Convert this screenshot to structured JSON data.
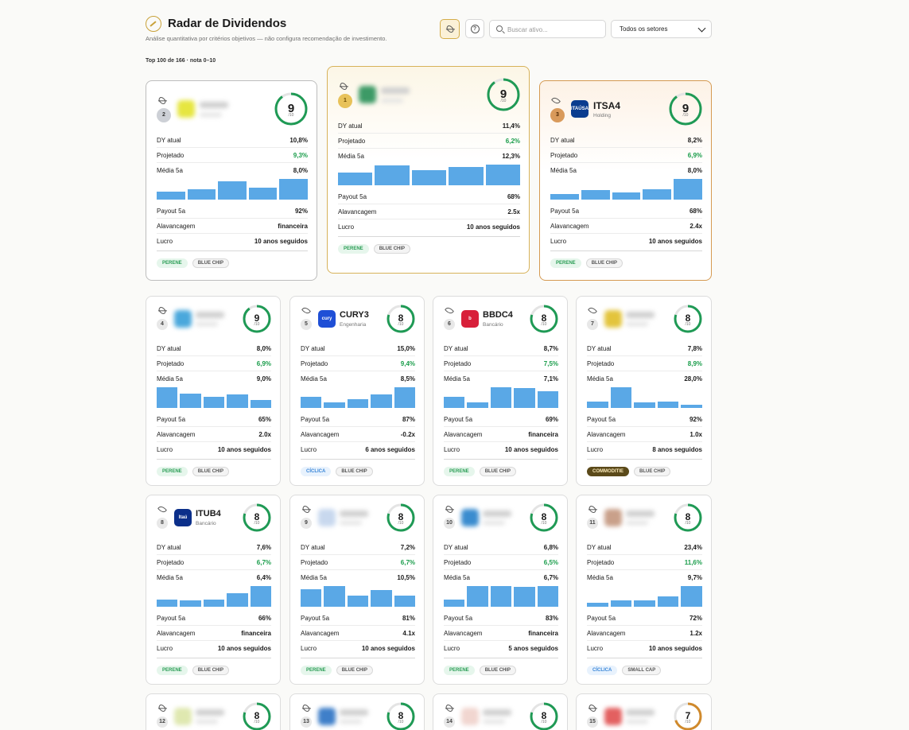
{
  "header": {
    "title": "Radar de Dividendos",
    "subtitle": "Análise quantitativa por critérios objetivos — não configura recomendação de investimento.",
    "search_placeholder": "Buscar ativo...",
    "sector_select": "Todos os setores",
    "count": "Top 100 de 166 · nota 0–10"
  },
  "labels": {
    "dy": "DY atual",
    "proj": "Projetado",
    "media": "Média 5a",
    "payout": "Payout 5a",
    "alav": "Alavancagem",
    "lucro": "Lucro",
    "of10": "/10"
  },
  "colors": {
    "accent": "#c9a23a",
    "bar": "#5aa8e6",
    "ring_green": "#1f9a55",
    "ring_orange": "#d08a2c",
    "positive": "#1a9d4b"
  },
  "podium": [
    {
      "rank": "2",
      "ticker": "",
      "sector": "",
      "score": "9",
      "dy": "10,8%",
      "proj": "9,3%",
      "media": "8,0%",
      "bars": [
        0.38,
        0.5,
        0.9,
        0.58,
        1.0
      ],
      "payout": "92%",
      "alav": "financeira",
      "lucro": "10 anos seguidos",
      "tags": [
        "PERENE",
        "BLUE CHIP"
      ],
      "blurred": true,
      "logo_color": "#e6e640"
    },
    {
      "rank": "1",
      "ticker": "",
      "sector": "",
      "score": "9",
      "dy": "11,4%",
      "proj": "6,2%",
      "media": "12,3%",
      "bars": [
        0.6,
        0.95,
        0.75,
        0.88,
        1.0
      ],
      "payout": "68%",
      "alav": "2.5x",
      "lucro": "10 anos seguidos",
      "tags": [
        "PERENE",
        "BLUE CHIP"
      ],
      "blurred": true,
      "logo_color": "#3d9a66"
    },
    {
      "rank": "3",
      "ticker": "ITSA4",
      "sector": "Holding",
      "score": "9",
      "dy": "8,2%",
      "proj": "6,9%",
      "media": "8,0%",
      "bars": [
        0.28,
        0.45,
        0.35,
        0.5,
        1.0
      ],
      "payout": "68%",
      "alav": "2.4x",
      "lucro": "10 anos seguidos",
      "tags": [
        "PERENE",
        "BLUE CHIP"
      ],
      "blurred": false,
      "logo_color": "#0a3d8f",
      "logo_text": "ITAÚSA"
    }
  ],
  "cards": [
    {
      "rank": "4",
      "ticker": "",
      "sector": "",
      "score": "9",
      "dy": "8,0%",
      "proj": "6,9%",
      "media": "9,0%",
      "bars": [
        1.0,
        0.7,
        0.55,
        0.65,
        0.4
      ],
      "payout": "65%",
      "alav": "2.0x",
      "lucro": "10 anos seguidos",
      "tags": [
        "PERENE",
        "BLUE CHIP"
      ],
      "blurred": true,
      "logo_color": "#4aa8dc",
      "eye": "slash"
    },
    {
      "rank": "5",
      "ticker": "CURY3",
      "sector": "Engenharia",
      "score": "8",
      "dy": "15,0%",
      "proj": "9,4%",
      "media": "8,5%",
      "bars": [
        0.55,
        0.28,
        0.42,
        0.65,
        1.0
      ],
      "payout": "87%",
      "alav": "-0.2x",
      "lucro": "6 anos seguidos",
      "tags": [
        "CÍCLICA",
        "BLUE CHIP"
      ],
      "blurred": false,
      "logo_color": "#1f4fd6",
      "logo_text": "cury",
      "eye": "open"
    },
    {
      "rank": "6",
      "ticker": "BBDC4",
      "sector": "Bancário",
      "score": "8",
      "dy": "8,7%",
      "proj": "7,5%",
      "media": "7,1%",
      "bars": [
        0.52,
        0.28,
        1.0,
        0.95,
        0.8
      ],
      "payout": "69%",
      "alav": "financeira",
      "lucro": "10 anos seguidos",
      "tags": [
        "PERENE",
        "BLUE CHIP"
      ],
      "blurred": false,
      "logo_color": "#d8203a",
      "logo_text": "b",
      "eye": "open"
    },
    {
      "rank": "7",
      "ticker": "",
      "sector": "",
      "score": "8",
      "dy": "7,8%",
      "proj": "8,9%",
      "media": "28,0%",
      "bars": [
        0.3,
        1.0,
        0.27,
        0.32,
        0.15
      ],
      "payout": "92%",
      "alav": "1.0x",
      "lucro": "8 anos seguidos",
      "tags": [
        "COMMODITIE",
        "BLUE CHIP"
      ],
      "blurred": true,
      "logo_color": "#e3c43c",
      "eye": "open"
    },
    {
      "rank": "8",
      "ticker": "ITUB4",
      "sector": "Bancário",
      "score": "8",
      "dy": "7,6%",
      "proj": "6,7%",
      "media": "6,4%",
      "bars": [
        0.35,
        0.3,
        0.33,
        0.65,
        1.0
      ],
      "payout": "66%",
      "alav": "financeira",
      "lucro": "10 anos seguidos",
      "tags": [
        "PERENE",
        "BLUE CHIP"
      ],
      "blurred": false,
      "logo_color": "#0b2f8a",
      "logo_text": "Itaú",
      "eye": "open"
    },
    {
      "rank": "9",
      "ticker": "",
      "sector": "",
      "score": "8",
      "dy": "7,2%",
      "proj": "6,7%",
      "media": "10,5%",
      "bars": [
        0.85,
        1.0,
        0.55,
        0.8,
        0.55
      ],
      "payout": "81%",
      "alav": "4.1x",
      "lucro": "10 anos seguidos",
      "tags": [
        "PERENE",
        "BLUE CHIP"
      ],
      "blurred": true,
      "logo_color": "#c8d8ee",
      "eye": "slash"
    },
    {
      "rank": "10",
      "ticker": "",
      "sector": "",
      "score": "8",
      "dy": "6,8%",
      "proj": "6,5%",
      "media": "6,7%",
      "bars": [
        0.35,
        1.0,
        1.0,
        0.95,
        1.0
      ],
      "payout": "83%",
      "alav": "financeira",
      "lucro": "5 anos seguidos",
      "tags": [
        "PERENE",
        "BLUE CHIP"
      ],
      "blurred": true,
      "logo_color": "#3a8ccf",
      "eye": "slash"
    },
    {
      "rank": "11",
      "ticker": "",
      "sector": "",
      "score": "8",
      "dy": "23,4%",
      "proj": "11,6%",
      "media": "9,7%",
      "bars": [
        0.2,
        0.3,
        0.32,
        0.5,
        1.0
      ],
      "payout": "72%",
      "alav": "1.2x",
      "lucro": "10 anos seguidos",
      "tags": [
        "CÍCLICA",
        "SMALL CAP"
      ],
      "blurred": true,
      "logo_color": "#c9a08a",
      "eye": "slash"
    },
    {
      "rank": "12",
      "ticker": "",
      "sector": "",
      "score": "8",
      "blurred": true,
      "logo_color": "#dfe8b0",
      "eye": "slash"
    },
    {
      "rank": "13",
      "ticker": "",
      "sector": "",
      "score": "8",
      "blurred": true,
      "logo_color": "#3f7fc9",
      "eye": "slash"
    },
    {
      "rank": "14",
      "ticker": "",
      "sector": "",
      "score": "8",
      "blurred": true,
      "logo_color": "#f1d6d0",
      "eye": "slash"
    },
    {
      "rank": "15",
      "ticker": "",
      "sector": "",
      "score": "7",
      "blurred": true,
      "logo_color": "#e36060",
      "eye": "slash",
      "ring": "orange"
    }
  ]
}
